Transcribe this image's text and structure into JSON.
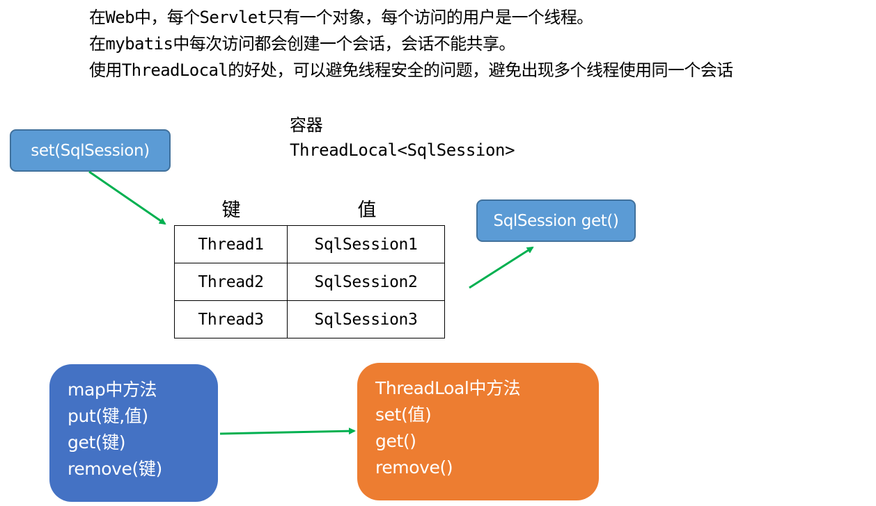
{
  "intro": [
    "在Web中，每个Servlet只有一个对象，每个访问的用户是一个线程。",
    "在mybatis中每次访问都会创建一个会话，会话不能共享。",
    "使用ThreadLocal的好处，可以避免线程安全的问题，避免出现多个线程使用同一个会话"
  ],
  "container": {
    "title": "容器",
    "type": "ThreadLocal<SqlSession>"
  },
  "set_box": {
    "label": "set(SqlSession)"
  },
  "get_box": {
    "label": "SqlSession get()"
  },
  "table": {
    "headers": [
      "键",
      "值"
    ],
    "rows": [
      [
        "Thread1",
        "SqlSession1"
      ],
      [
        "Thread2",
        "SqlSession2"
      ],
      [
        "Thread3",
        "SqlSession3"
      ]
    ]
  },
  "map_box": {
    "lines": [
      "map中方法",
      "put(键,值)",
      "get(键)",
      "remove(键)"
    ]
  },
  "threadlocal_box": {
    "lines": [
      "ThreadLoal中方法",
      "set(值)",
      "get()",
      "remove()"
    ]
  },
  "colors": {
    "blue_small": "#5b9bd5",
    "blue_big": "#4472c4",
    "orange": "#ed7d31",
    "arrow": "#00b050"
  }
}
